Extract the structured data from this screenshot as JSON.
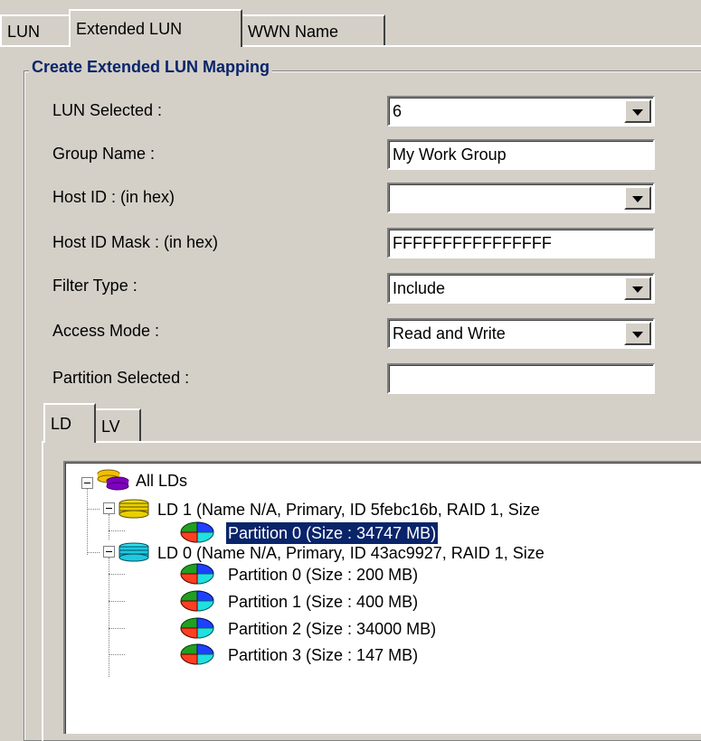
{
  "tabs": [
    {
      "label": "LUN",
      "selected": false
    },
    {
      "label": "Extended LUN",
      "selected": true
    },
    {
      "label": "WWN Name",
      "selected": false
    }
  ],
  "group_title": "Create Extended LUN Mapping",
  "form": {
    "lun_selected": {
      "label": "LUN Selected :",
      "value": "6"
    },
    "group_name": {
      "label": "Group Name :",
      "value": "My Work Group"
    },
    "host_id": {
      "label": "Host ID : (in hex)",
      "value": ""
    },
    "host_id_mask": {
      "label": "Host ID Mask : (in hex)",
      "value": "FFFFFFFFFFFFFFFF"
    },
    "filter_type": {
      "label": "Filter Type :",
      "value": "Include"
    },
    "access_mode": {
      "label": "Access Mode :",
      "value": "Read and Write"
    },
    "partition_selected": {
      "label": "Partition Selected :",
      "value": ""
    }
  },
  "inner_tabs": [
    {
      "label": "LD",
      "selected": true
    },
    {
      "label": "LV",
      "selected": false
    }
  ],
  "tree": {
    "root": "All LDs",
    "ld1": {
      "label": "LD 1 (Name N/A, Primary, ID 5febc16b, RAID 1, Size",
      "partitions": [
        "Partition 0 (Size : 34747 MB)"
      ],
      "icon": "yellow-disk-stack-icon"
    },
    "ld0": {
      "label": "LD 0 (Name N/A, Primary, ID 43ac9927, RAID 1, Size",
      "partitions": [
        "Partition 0 (Size : 200 MB)",
        "Partition 1 (Size : 400 MB)",
        "Partition 2 (Size : 34000 MB)",
        "Partition 3 (Size : 147 MB)"
      ],
      "icon": "cyan-disk-stack-icon"
    },
    "selected_partition": "LD 1 / Partition 0"
  },
  "colors": {
    "background": "#d4d0c8",
    "group_title": "#0a246a",
    "selection": "#0a246a"
  }
}
